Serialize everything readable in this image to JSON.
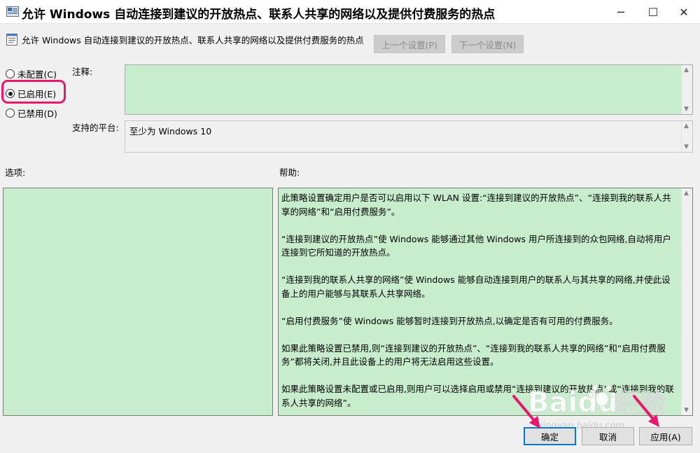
{
  "window": {
    "title": "允许 Windows 自动连接到建议的开放热点、联系人共享的网络以及提供付费服务的热点",
    "controls": {
      "minimize": "─",
      "maximize": "☐",
      "close": "✕"
    }
  },
  "header": {
    "policy_name": "允许 Windows 自动连接到建议的开放热点、联系人共享的网络以及提供付费服务的热点",
    "prev_button": "上一个设置(P)",
    "next_button": "下一个设置(N)"
  },
  "state_options": [
    {
      "label": "未配置(C)",
      "selected": false
    },
    {
      "label": "已启用(E)",
      "selected": true
    },
    {
      "label": "已禁用(D)",
      "selected": false
    }
  ],
  "comment": {
    "label": "注释:",
    "value": ""
  },
  "platform": {
    "label": "支持的平台:",
    "value": "至少为 Windows 10"
  },
  "options_label": "选项:",
  "help_label": "帮助:",
  "help_paragraphs": [
    "此策略设置确定用户是否可以启用以下 WLAN 设置:“连接到建议的开放热点”、“连接到我的联系人共享的网络”和“启用付费服务”。",
    "“连接到建议的开放热点”使 Windows 能够通过其他 Windows 用户所连接到的众包网络,自动将用户连接到它所知道的开放热点。",
    "“连接到我的联系人共享的网络”使 Windows 能够自动连接到用户的联系人与其共享的网络,并使此设备上的用户能够与其联系人共享网络。",
    "“启用付费服务”使 Windows 能够暂时连接到开放热点,以确定是否有可用的付费服务。",
    "如果此策略设置已禁用,则“连接到建议的开放热点”、“连接到我的联系人共享的网络”和“启用付费服务”都将关闭,并且此设备上的用户将无法启用这些设置。",
    "如果此策略设置未配置或已启用,则用户可以选择启用或禁用“连接到建议的开放热点”或“连接到我的联系人共享的网络”。"
  ],
  "footer": {
    "ok": "确定",
    "cancel": "取消",
    "apply": "应用(A)"
  },
  "watermark": {
    "brand": "Baidu",
    "cn": "经验",
    "url": "jingyan.baidu.com"
  },
  "colors": {
    "pane_bg": "#c7edcc",
    "accent": "#0078d7",
    "annotation": "#e8196b"
  }
}
